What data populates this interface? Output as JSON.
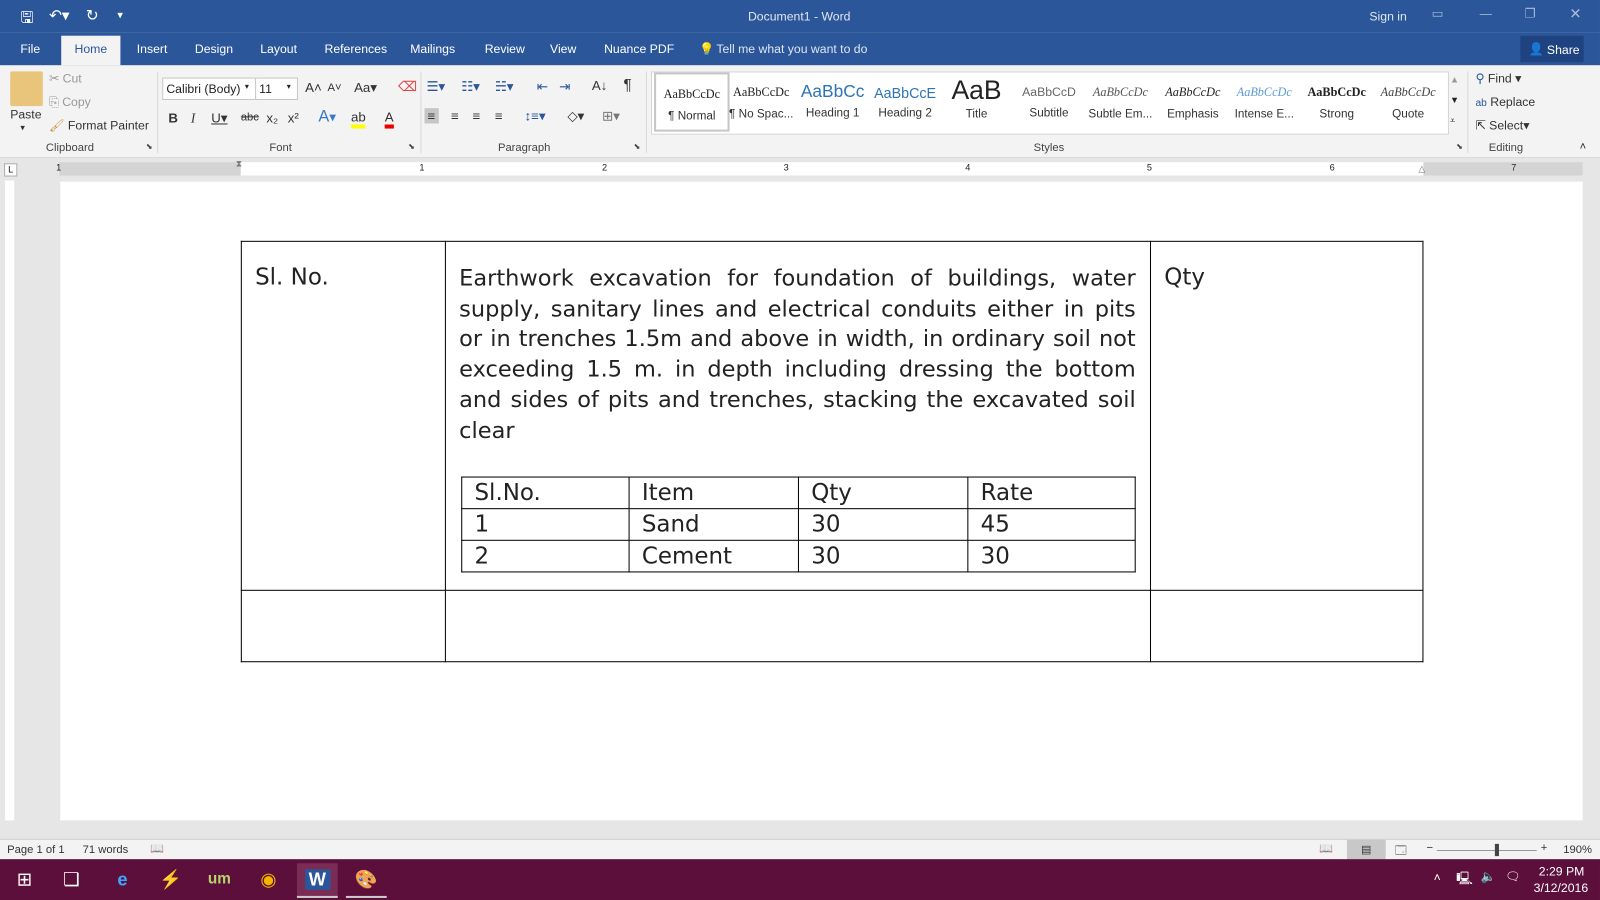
{
  "window": {
    "title": "Document1 - Word",
    "sign_in": "Sign in"
  },
  "tabs": [
    "File",
    "Home",
    "Insert",
    "Design",
    "Layout",
    "References",
    "Mailings",
    "Review",
    "View",
    "Nuance PDF"
  ],
  "tell_me": "Tell me what you want to do",
  "share": "Share",
  "clipboard": {
    "paste": "Paste",
    "cut": "Cut",
    "copy": "Copy",
    "format_painter": "Format Painter",
    "label": "Clipboard"
  },
  "font": {
    "name": "Calibri (Body)",
    "size": "11",
    "case": "Aa",
    "label": "Font"
  },
  "paragraph": {
    "label": "Paragraph"
  },
  "styles": {
    "label": "Styles",
    "items": [
      {
        "preview": "AaBbCcDc",
        "name": "¶ Normal"
      },
      {
        "preview": "AaBbCcDc",
        "name": "¶ No Spac..."
      },
      {
        "preview": "AaBbCc",
        "name": "Heading 1"
      },
      {
        "preview": "AaBbCcE",
        "name": "Heading 2"
      },
      {
        "preview": "AaB",
        "name": "Title"
      },
      {
        "preview": "AaBbCcD",
        "name": "Subtitle"
      },
      {
        "preview": "AaBbCcDc",
        "name": "Subtle Em..."
      },
      {
        "preview": "AaBbCcDc",
        "name": "Emphasis"
      },
      {
        "preview": "AaBbCcDc",
        "name": "Intense E..."
      },
      {
        "preview": "AaBbCcDc",
        "name": "Strong"
      },
      {
        "preview": "AaBbCcDc",
        "name": "Quote"
      }
    ]
  },
  "editing": {
    "find": "Find",
    "replace": "Replace",
    "select": "Select",
    "label": "Editing"
  },
  "ruler": [
    "1",
    "1",
    "2",
    "3",
    "4",
    "5",
    "6",
    "7"
  ],
  "document": {
    "col1": "Sl. No.",
    "description": "Earthwork excavation  for foundation of buildings, water supply, sanitary lines and electrical conduits either in pits or in trenches 1.5m and above in width, in ordinary soil not exceeding 1.5 m. in depth including dressing the bottom and sides of pits and trenches, stacking the excavated soil clear",
    "col3": "Qty",
    "inner_table": {
      "headers": [
        "Sl.No.",
        "Item",
        "Qty",
        "Rate"
      ],
      "rows": [
        [
          "1",
          "Sand",
          "30",
          "45"
        ],
        [
          "2",
          "Cement",
          "30",
          "30"
        ]
      ]
    }
  },
  "status": {
    "page": "Page 1 of 1",
    "words": "71 words",
    "zoom": "190%"
  },
  "taskbar": {
    "time": "2:29 PM",
    "date": "3/12/2016"
  }
}
